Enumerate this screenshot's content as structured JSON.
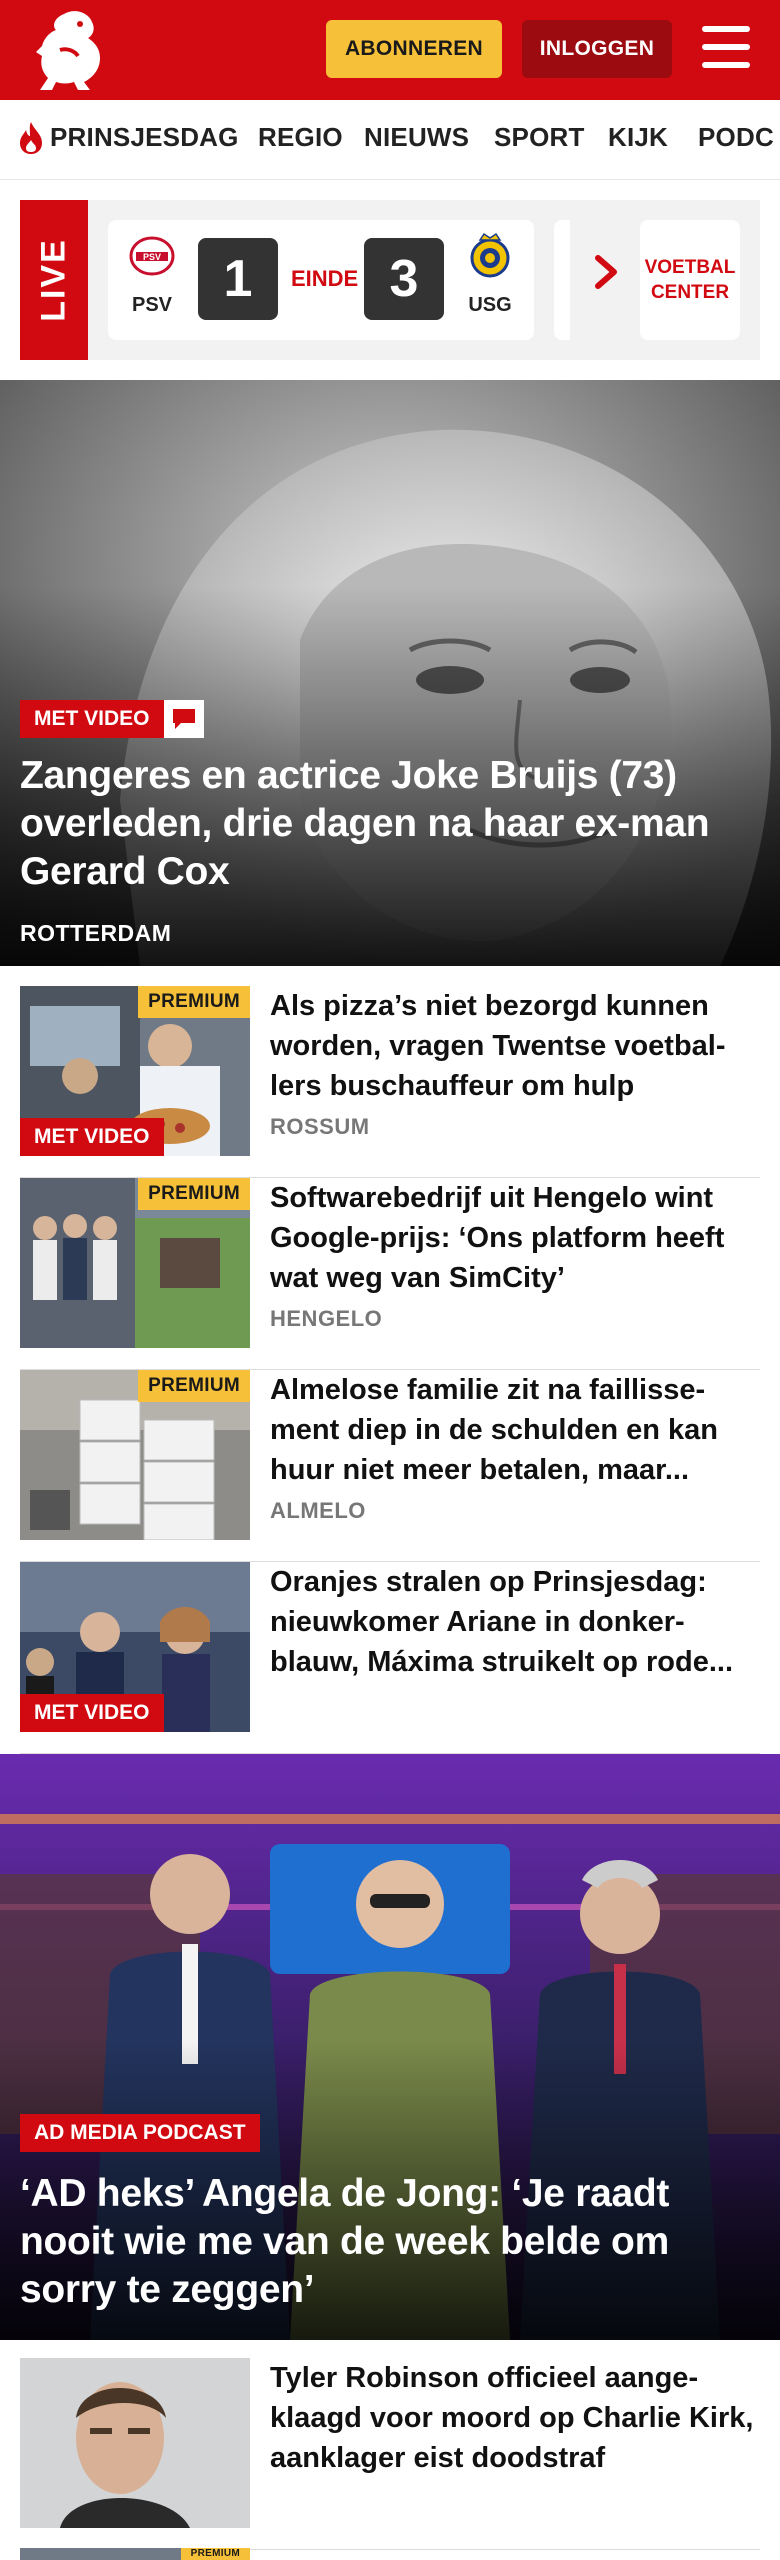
{
  "header": {
    "subscribe_label": "ABONNEREN",
    "login_label": "INLOGGEN",
    "brand_color": "#d10a11",
    "logo_icon": "twente-horse-logo-icon",
    "menu_icon": "hamburger-menu-icon"
  },
  "nav": {
    "items": [
      {
        "label": "PRINSJESDAG",
        "icon": "flame-icon"
      },
      {
        "label": "REGIO"
      },
      {
        "label": "NIEUWS"
      },
      {
        "label": "SPORT"
      },
      {
        "label": "KIJK"
      },
      {
        "label": "PODC"
      }
    ]
  },
  "live": {
    "tag": "LIVE",
    "match": {
      "home": "PSV",
      "home_score": "1",
      "status": "EINDE",
      "away_score": "3",
      "away": "USG"
    },
    "voetbal_center": "VOETBAL CENTER"
  },
  "hero": {
    "badge": "MET VIDEO",
    "title": "Zangeres en actrice Joke Bruijs (73) overleden, drie dagen na haar ex-man Gerard Cox",
    "location": "ROTTERDAM"
  },
  "articles": [
    {
      "premium": "PREMIUM",
      "video": "MET VIDEO",
      "title": "Als pizza’s niet bezorgd kunnen worden, vragen Twentse voetbal­lers buschauffeur om hulp",
      "location": "ROSSUM"
    },
    {
      "premium": "PREMIUM",
      "title": "Softwarebedrijf uit Hengelo wint Google-prijs: ‘Ons platform heeft wat weg van SimCity’",
      "location": "HENGELO"
    },
    {
      "premium": "PREMIUM",
      "title": "Almelose familie zit na faillisse­ment diep in de schulden en kan huur niet meer betalen, maar...",
      "location": "ALMELO"
    },
    {
      "video": "MET VIDEO",
      "title": "Oranjes stralen op Prinsjesdag: nieuwkomer Ariane in donker­blauw, Máxima struikelt op rode...",
      "location": ""
    }
  ],
  "feature": {
    "badge": "AD MEDIA PODCAST",
    "title": "‘AD heks’ Angela de Jong: ‘Je raadt nooit wie me van de week belde om sorry te zeggen’"
  },
  "bottom_article": {
    "title": "Tyler Robinson officieel aange­klaagd voor moord op Charlie Kirk, aanklager eist doodstraf",
    "next_premium": "PREMIUM"
  }
}
